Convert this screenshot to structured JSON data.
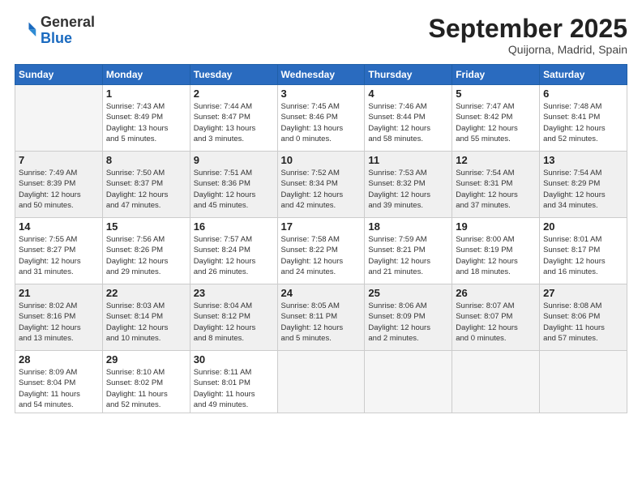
{
  "header": {
    "logo_line1": "General",
    "logo_line2": "Blue",
    "month": "September 2025",
    "location": "Quijorna, Madrid, Spain"
  },
  "weekdays": [
    "Sunday",
    "Monday",
    "Tuesday",
    "Wednesday",
    "Thursday",
    "Friday",
    "Saturday"
  ],
  "weeks": [
    [
      {
        "day": "",
        "info": ""
      },
      {
        "day": "1",
        "info": "Sunrise: 7:43 AM\nSunset: 8:49 PM\nDaylight: 13 hours\nand 5 minutes."
      },
      {
        "day": "2",
        "info": "Sunrise: 7:44 AM\nSunset: 8:47 PM\nDaylight: 13 hours\nand 3 minutes."
      },
      {
        "day": "3",
        "info": "Sunrise: 7:45 AM\nSunset: 8:46 PM\nDaylight: 13 hours\nand 0 minutes."
      },
      {
        "day": "4",
        "info": "Sunrise: 7:46 AM\nSunset: 8:44 PM\nDaylight: 12 hours\nand 58 minutes."
      },
      {
        "day": "5",
        "info": "Sunrise: 7:47 AM\nSunset: 8:42 PM\nDaylight: 12 hours\nand 55 minutes."
      },
      {
        "day": "6",
        "info": "Sunrise: 7:48 AM\nSunset: 8:41 PM\nDaylight: 12 hours\nand 52 minutes."
      }
    ],
    [
      {
        "day": "7",
        "info": "Sunrise: 7:49 AM\nSunset: 8:39 PM\nDaylight: 12 hours\nand 50 minutes."
      },
      {
        "day": "8",
        "info": "Sunrise: 7:50 AM\nSunset: 8:37 PM\nDaylight: 12 hours\nand 47 minutes."
      },
      {
        "day": "9",
        "info": "Sunrise: 7:51 AM\nSunset: 8:36 PM\nDaylight: 12 hours\nand 45 minutes."
      },
      {
        "day": "10",
        "info": "Sunrise: 7:52 AM\nSunset: 8:34 PM\nDaylight: 12 hours\nand 42 minutes."
      },
      {
        "day": "11",
        "info": "Sunrise: 7:53 AM\nSunset: 8:32 PM\nDaylight: 12 hours\nand 39 minutes."
      },
      {
        "day": "12",
        "info": "Sunrise: 7:54 AM\nSunset: 8:31 PM\nDaylight: 12 hours\nand 37 minutes."
      },
      {
        "day": "13",
        "info": "Sunrise: 7:54 AM\nSunset: 8:29 PM\nDaylight: 12 hours\nand 34 minutes."
      }
    ],
    [
      {
        "day": "14",
        "info": "Sunrise: 7:55 AM\nSunset: 8:27 PM\nDaylight: 12 hours\nand 31 minutes."
      },
      {
        "day": "15",
        "info": "Sunrise: 7:56 AM\nSunset: 8:26 PM\nDaylight: 12 hours\nand 29 minutes."
      },
      {
        "day": "16",
        "info": "Sunrise: 7:57 AM\nSunset: 8:24 PM\nDaylight: 12 hours\nand 26 minutes."
      },
      {
        "day": "17",
        "info": "Sunrise: 7:58 AM\nSunset: 8:22 PM\nDaylight: 12 hours\nand 24 minutes."
      },
      {
        "day": "18",
        "info": "Sunrise: 7:59 AM\nSunset: 8:21 PM\nDaylight: 12 hours\nand 21 minutes."
      },
      {
        "day": "19",
        "info": "Sunrise: 8:00 AM\nSunset: 8:19 PM\nDaylight: 12 hours\nand 18 minutes."
      },
      {
        "day": "20",
        "info": "Sunrise: 8:01 AM\nSunset: 8:17 PM\nDaylight: 12 hours\nand 16 minutes."
      }
    ],
    [
      {
        "day": "21",
        "info": "Sunrise: 8:02 AM\nSunset: 8:16 PM\nDaylight: 12 hours\nand 13 minutes."
      },
      {
        "day": "22",
        "info": "Sunrise: 8:03 AM\nSunset: 8:14 PM\nDaylight: 12 hours\nand 10 minutes."
      },
      {
        "day": "23",
        "info": "Sunrise: 8:04 AM\nSunset: 8:12 PM\nDaylight: 12 hours\nand 8 minutes."
      },
      {
        "day": "24",
        "info": "Sunrise: 8:05 AM\nSunset: 8:11 PM\nDaylight: 12 hours\nand 5 minutes."
      },
      {
        "day": "25",
        "info": "Sunrise: 8:06 AM\nSunset: 8:09 PM\nDaylight: 12 hours\nand 2 minutes."
      },
      {
        "day": "26",
        "info": "Sunrise: 8:07 AM\nSunset: 8:07 PM\nDaylight: 12 hours\nand 0 minutes."
      },
      {
        "day": "27",
        "info": "Sunrise: 8:08 AM\nSunset: 8:06 PM\nDaylight: 11 hours\nand 57 minutes."
      }
    ],
    [
      {
        "day": "28",
        "info": "Sunrise: 8:09 AM\nSunset: 8:04 PM\nDaylight: 11 hours\nand 54 minutes."
      },
      {
        "day": "29",
        "info": "Sunrise: 8:10 AM\nSunset: 8:02 PM\nDaylight: 11 hours\nand 52 minutes."
      },
      {
        "day": "30",
        "info": "Sunrise: 8:11 AM\nSunset: 8:01 PM\nDaylight: 11 hours\nand 49 minutes."
      },
      {
        "day": "",
        "info": ""
      },
      {
        "day": "",
        "info": ""
      },
      {
        "day": "",
        "info": ""
      },
      {
        "day": "",
        "info": ""
      }
    ]
  ]
}
